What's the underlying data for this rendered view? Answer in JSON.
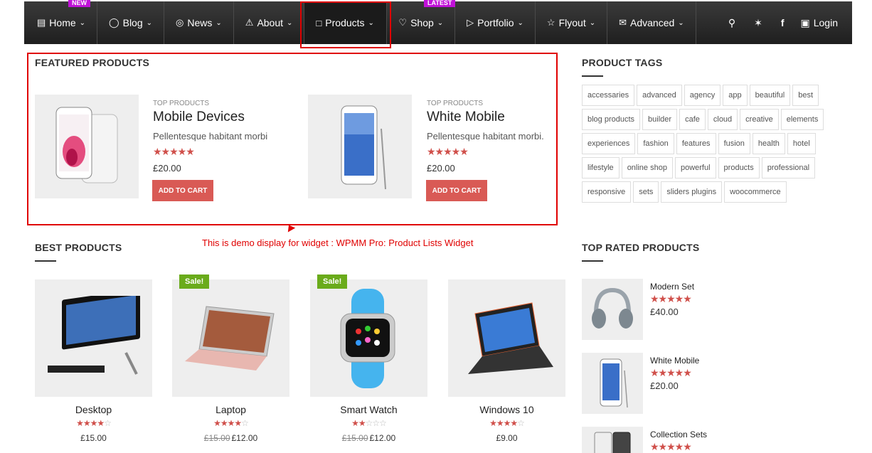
{
  "nav": {
    "items": [
      {
        "label": "Home",
        "icon": "monitor-icon"
      },
      {
        "label": "Blog",
        "icon": "speech-bubble-icon"
      },
      {
        "label": "News",
        "icon": "globe-icon"
      },
      {
        "label": "About",
        "icon": "bell-slash-icon"
      },
      {
        "label": "Products",
        "icon": "tshirt-icon"
      },
      {
        "label": "Shop",
        "icon": "heart-icon"
      },
      {
        "label": "Portfolio",
        "icon": "tag-icon"
      },
      {
        "label": "Flyout",
        "icon": "star-icon"
      },
      {
        "label": "Advanced",
        "icon": "envelope-icon"
      }
    ],
    "badge_new": "NEW",
    "badge_latest": "LATEST",
    "login": "Login"
  },
  "featured": {
    "title": "FEATURED PRODUCTS",
    "products": [
      {
        "category": "TOP PRODUCTS",
        "name": "Mobile Devices",
        "desc": "Pellentesque habitant morbi",
        "price": "£20.00",
        "cart": "ADD TO CART"
      },
      {
        "category": "TOP PRODUCTS",
        "name": "White Mobile",
        "desc": "Pellentesque habitant morbi.",
        "price": "£20.00",
        "cart": "ADD TO CART"
      }
    ]
  },
  "demo_note": "This is demo display for widget : WPMM Pro: Product Lists Widget",
  "best": {
    "title": "BEST PRODUCTS",
    "sale_label": "Sale!",
    "products": [
      {
        "name": "Desktop",
        "rating": 4,
        "price": "£15.00",
        "old_price": ""
      },
      {
        "name": "Laptop",
        "rating": 4,
        "price": "£12.00",
        "old_price": "£15.00"
      },
      {
        "name": "Smart Watch",
        "rating": 2,
        "price": "£12.00",
        "old_price": "£15.00"
      },
      {
        "name": "Windows 10",
        "rating": 4,
        "price": "£9.00",
        "old_price": ""
      }
    ]
  },
  "tags": {
    "title": "PRODUCT TAGS",
    "list": [
      "accessaries",
      "advanced",
      "agency",
      "app",
      "beautiful",
      "best",
      "blog products",
      "builder",
      "cafe",
      "cloud",
      "creative",
      "elements",
      "experiences",
      "fashion",
      "features",
      "fusion",
      "health",
      "hotel",
      "lifestyle",
      "online shop",
      "powerful",
      "products",
      "professional",
      "responsive",
      "sets",
      "sliders plugins",
      "woocommerce"
    ]
  },
  "top_rated": {
    "title": "TOP RATED PRODUCTS",
    "products": [
      {
        "name": "Modern Set",
        "rating": 5,
        "price": "£40.00"
      },
      {
        "name": "White Mobile",
        "rating": 5,
        "price": "£20.00"
      },
      {
        "name": "Collection Sets",
        "rating": 5,
        "price": ""
      }
    ]
  },
  "colors": {
    "accent": "#d95a55",
    "badge": "#c011d8",
    "sale": "#6aab1b",
    "annotation": "#e00000"
  }
}
